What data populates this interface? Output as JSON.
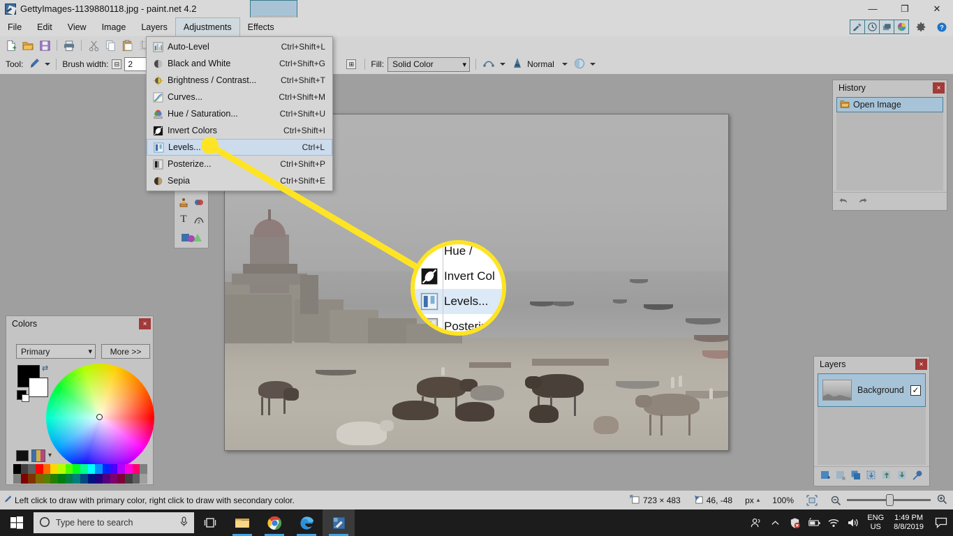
{
  "window": {
    "title": "GettyImages-1139880118.jpg - paint.net 4.2",
    "app_icon": "paintnet-icon",
    "minimize": "—",
    "maximize": "❐",
    "close": "✕",
    "tab_chevron": "⌄"
  },
  "menubar": {
    "items": [
      {
        "label": "File",
        "active": false
      },
      {
        "label": "Edit",
        "active": false
      },
      {
        "label": "View",
        "active": false
      },
      {
        "label": "Image",
        "active": false
      },
      {
        "label": "Layers",
        "active": false
      },
      {
        "label": "Adjustments",
        "active": true
      },
      {
        "label": "Effects",
        "active": false
      }
    ],
    "right_toggles": [
      "tools-window-toggle",
      "history-window-toggle",
      "layers-window-toggle",
      "colors-window-toggle"
    ],
    "settings_icon": "gear-icon",
    "help_icon": "help-icon"
  },
  "toolbar": {
    "buttons": [
      "new-icon",
      "open-icon",
      "save-icon",
      "print-icon",
      "cut-icon",
      "copy-icon",
      "paste-icon",
      "crop-to-selection-icon"
    ]
  },
  "tool_options": {
    "tool_label": "Tool:",
    "tool_icon": "paintbrush-icon",
    "brush_width_label": "Brush width:",
    "brush_width_value": "2",
    "brush_decrement": "⊟",
    "brush_increment": "⊞",
    "fill_label": "Fill:",
    "fill_value": "Solid Color",
    "antialias_icon": "antialiasing-icon",
    "blend_label": "Normal",
    "blend_icon": "blend-mode-icon",
    "alpha_icon": "alpha-blending-icon"
  },
  "adjustments_menu": {
    "items": [
      {
        "icon": "auto-level-icon",
        "label": "Auto-Level",
        "shortcut": "Ctrl+Shift+L",
        "selected": false
      },
      {
        "icon": "black-and-white-icon",
        "label": "Black and White",
        "shortcut": "Ctrl+Shift+G",
        "selected": false
      },
      {
        "icon": "brightness-contrast-icon",
        "label": "Brightness / Contrast...",
        "shortcut": "Ctrl+Shift+T",
        "selected": false
      },
      {
        "icon": "curves-icon",
        "label": "Curves...",
        "shortcut": "Ctrl+Shift+M",
        "selected": false
      },
      {
        "icon": "hue-saturation-icon",
        "label": "Hue / Saturation...",
        "shortcut": "Ctrl+Shift+U",
        "selected": false
      },
      {
        "icon": "invert-colors-icon",
        "label": "Invert Colors",
        "shortcut": "Ctrl+Shift+I",
        "selected": false
      },
      {
        "icon": "levels-icon",
        "label": "Levels...",
        "shortcut": "Ctrl+L",
        "selected": true
      },
      {
        "icon": "posterize-icon",
        "label": "Posterize...",
        "shortcut": "Ctrl+Shift+P",
        "selected": false
      },
      {
        "icon": "sepia-icon",
        "label": "Sepia",
        "shortcut": "Ctrl+Shift+E",
        "selected": false
      }
    ]
  },
  "magnifier": {
    "rows": [
      {
        "icon": "hue-saturation-icon",
        "label": "Hue /",
        "selected": false
      },
      {
        "icon": "invert-colors-icon",
        "label": "Invert Col",
        "selected": false
      },
      {
        "icon": "levels-icon",
        "label": "Levels...",
        "selected": true
      },
      {
        "icon": "posterize-icon",
        "label": "Posterize",
        "selected": false
      }
    ],
    "highlight_color": "#ffe425"
  },
  "toolbox": {
    "tools": [
      "ellipse-select-icon",
      "zoom-icon",
      "magic-wand-icon",
      "pan-icon",
      "paint-bucket-icon",
      "gradient-icon",
      "paintbrush-icon",
      "eraser-icon",
      "pencil-icon",
      "color-picker-icon",
      "clone-stamp-icon",
      "recolor-icon",
      "text-icon",
      "line-curve-icon",
      "shapes-icon"
    ],
    "selected_index": 6
  },
  "colors_window": {
    "title": "Colors",
    "close": "×",
    "mode_value": "Primary",
    "more_button": "More >>",
    "primary_color": "#000000",
    "secondary_color": "#ffffff",
    "swap_icon": "swap-colors-icon",
    "add-color_icon": "add-color-icon",
    "palette_icon": "palette-icon",
    "palette_caret": "▾",
    "palette_row1": [
      "#000000",
      "#404040",
      "#606060",
      "#ff0000",
      "#ff6a00",
      "#ffd800",
      "#b6ff00",
      "#4cff00",
      "#00ff21",
      "#00ff90",
      "#00ffff",
      "#0094ff",
      "#0026ff",
      "#4800ff",
      "#b200ff",
      "#ff00dc",
      "#ff006e",
      "#808080"
    ],
    "palette_row2": [
      "#7f7f7f",
      "#7f0000",
      "#7f3300",
      "#7f6a00",
      "#5b7f00",
      "#267f00",
      "#007f0e",
      "#007f46",
      "#007f7f",
      "#004a7f",
      "#00137f",
      "#21007f",
      "#57007f",
      "#7f006e",
      "#7f0037",
      "#3f3f3f",
      "#5f5f5f",
      "#9f9f9f"
    ]
  },
  "history_window": {
    "title": "History",
    "close": "×",
    "items": [
      {
        "icon": "open-image-icon",
        "label": "Open Image",
        "selected": true
      }
    ],
    "undo_icon": "undo-icon",
    "redo_icon": "redo-icon"
  },
  "layers_window": {
    "title": "Layers",
    "close": "×",
    "items": [
      {
        "thumb": "layer-thumbnail",
        "name": "Background",
        "visible": true,
        "checkmark": "✓",
        "selected": true
      }
    ],
    "footer_buttons": [
      "add-layer-icon",
      "delete-layer-icon",
      "duplicate-layer-icon",
      "merge-layer-down-icon",
      "move-layer-up-icon",
      "move-layer-down-icon",
      "layer-properties-icon"
    ]
  },
  "statusbar": {
    "hint_icon": "paintbrush-icon",
    "hint": "Left click to draw with primary color, right click to draw with secondary color.",
    "image_size_icon": "image-size-icon",
    "image_size": "723 × 483",
    "cursor_icon": "cursor-position-icon",
    "cursor_position": "46, -48",
    "units": "px",
    "units_caret": "▴",
    "zoom_level": "100%",
    "fit_icon": "fit-to-window-icon",
    "zoom_out_icon": "zoom-out-icon",
    "zoom_in_icon": "zoom-in-icon"
  },
  "taskbar": {
    "start_icon": "windows-start-icon",
    "search_icon": "cortana-circle-icon",
    "search_placeholder": "Type here to search",
    "mic_icon": "microphone-icon",
    "task_view_icon": "task-view-icon",
    "apps": [
      {
        "icon": "file-explorer-icon",
        "running": true,
        "active": false
      },
      {
        "icon": "chrome-icon",
        "running": true,
        "active": false
      },
      {
        "icon": "edge-icon",
        "running": true,
        "active": false
      },
      {
        "icon": "paintnet-icon",
        "running": true,
        "active": true
      }
    ],
    "tray_icons": [
      "people-icon",
      "show-hidden-icons-chevron",
      "security-alert-icon",
      "battery-icon",
      "wifi-icon",
      "volume-icon"
    ],
    "language": "ENG",
    "region": "US",
    "time": "1:49 PM",
    "date": "8/8/2019",
    "action_center_icon": "action-center-icon"
  },
  "canvas": {
    "description": "river ghat scene with cattle on sand",
    "width": "723",
    "height": "483"
  }
}
